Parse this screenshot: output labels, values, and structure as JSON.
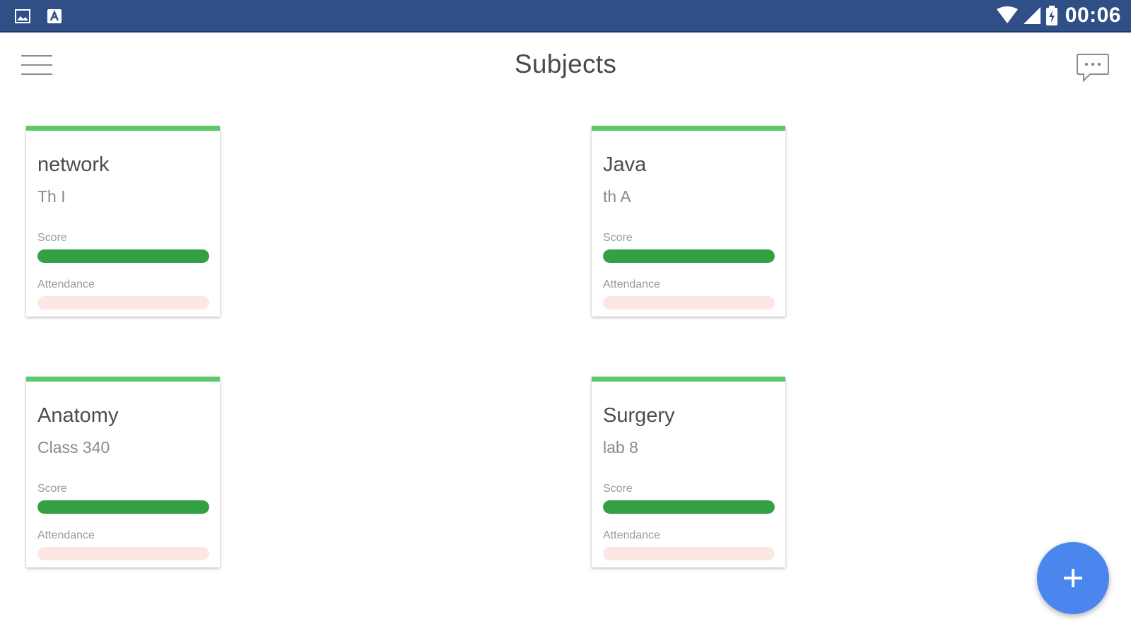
{
  "status_bar": {
    "left_icons": [
      "image-notification-icon",
      "app-notification-icon"
    ],
    "right_icons": [
      "wifi-icon",
      "cell-signal-icon",
      "battery-icon"
    ],
    "time": "00:06"
  },
  "app_bar": {
    "title": "Subjects",
    "menu_icon": "hamburger-menu-icon",
    "action_icon": "chat-bubble-icon"
  },
  "cards": [
    {
      "title": "network",
      "subtitle": "Th I",
      "score_label": "Score",
      "score_fraction": 1.0,
      "attendance_label": "Attendance",
      "attendance_fraction": 0.0
    },
    {
      "title": "Java",
      "subtitle": "th A",
      "score_label": "Score",
      "score_fraction": 1.0,
      "attendance_label": "Attendance",
      "attendance_fraction": 0.0
    },
    {
      "title": "Anatomy",
      "subtitle": "Class 340",
      "score_label": "Score",
      "score_fraction": 1.0,
      "attendance_label": "Attendance",
      "attendance_fraction": 0.0
    },
    {
      "title": "Surgery",
      "subtitle": "lab 8",
      "score_label": "Score",
      "score_fraction": 1.0,
      "attendance_label": "Attendance",
      "attendance_fraction": 0.0
    }
  ],
  "fab": {
    "icon": "plus-icon"
  },
  "colors": {
    "status_bar": "#2f4f86",
    "card_accent": "#5cc869",
    "score_fill": "#33a043",
    "score_track": "#dcefdc",
    "attendance_fill": "#e86b5a",
    "attendance_track": "#fde7e4",
    "fab": "#4a86ee"
  }
}
